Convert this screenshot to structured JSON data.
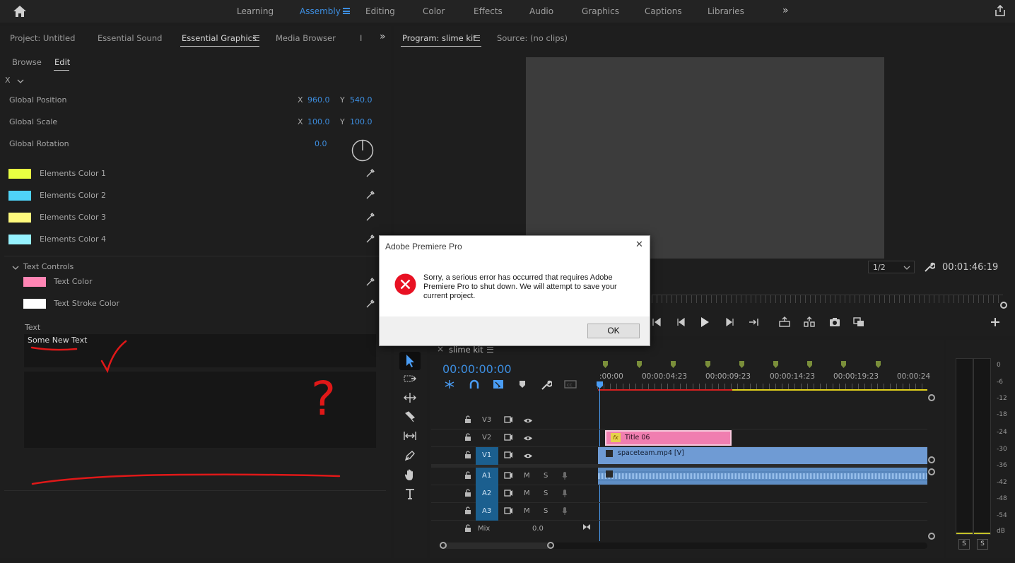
{
  "workspace_tabs": [
    "Learning",
    "Assembly",
    "Editing",
    "Color",
    "Effects",
    "Audio",
    "Graphics",
    "Captions",
    "Libraries"
  ],
  "workspace_active": "Assembly",
  "left_panel": {
    "tabs": [
      "Project: Untitled",
      "Essential Sound",
      "Essential Graphics",
      "Media Browser",
      "I"
    ],
    "active_tab": "Essential Graphics",
    "subtabs": [
      "Browse",
      "Edit"
    ],
    "active_subtab": "Edit",
    "layer_name": "X",
    "global_position": {
      "label": "Global Position",
      "x_label": "X",
      "x": "960.0",
      "y_label": "Y",
      "y": "540.0"
    },
    "global_scale": {
      "label": "Global Scale",
      "x_label": "X",
      "x": "100.0",
      "y_label": "Y",
      "y": "100.0"
    },
    "global_rotation": {
      "label": "Global Rotation",
      "value": "0.0"
    },
    "element_colors": [
      {
        "label": "Elements Color 1",
        "color": "#e8ff42"
      },
      {
        "label": "Elements Color 2",
        "color": "#4fd3f7"
      },
      {
        "label": "Elements Color 3",
        "color": "#fffa7d"
      },
      {
        "label": "Elements Color 4",
        "color": "#96f2ff"
      }
    ],
    "text_controls": {
      "label": "Text Controls",
      "items": [
        {
          "label": "Text Color",
          "color": "#ff85b4"
        },
        {
          "label": "Text Stroke Color",
          "color": "#ffffff"
        }
      ]
    },
    "text_label": "Text",
    "text_value": "Some New Text",
    "annotation_mark": "?"
  },
  "program_panel": {
    "tabs": [
      "Program: slime kit",
      "Source: (no clips)"
    ],
    "resolution": "1/2",
    "timecode": "00:01:46:19"
  },
  "dialog": {
    "title": "Adobe Premiere Pro",
    "message": "Sorry, a serious error has occurred that requires Adobe Premiere Pro to shut down. We will attempt to save your current project.",
    "ok_label": "OK",
    "close_glyph": "✕"
  },
  "timeline": {
    "close_glyph": "×",
    "sequence_name": "slime kit",
    "timecode": "00:00:00:00",
    "ruler_labels": [
      ":00:00",
      "00:00:04:23",
      "00:00:09:23",
      "00:00:14:23",
      "00:00:19:23",
      "00:00:24"
    ],
    "video_tracks": [
      "V3",
      "V2",
      "V1"
    ],
    "audio_tracks": [
      "A1",
      "A2",
      "A3"
    ],
    "mute_label": "M",
    "solo_label": "S",
    "mix_label": "Mix",
    "mix_value": "0.0",
    "clips": {
      "title": {
        "label": "Title 06",
        "fx": "fx",
        "color": "#f07eb0"
      },
      "video": {
        "label": "spaceteam.mp4 [V]",
        "color": "#6f9bd4"
      }
    }
  },
  "audio_meter": {
    "scale": [
      "0",
      "-6",
      "-12",
      "-18",
      "-24",
      "-30",
      "-36",
      "-42",
      "-48",
      "-54",
      "dB"
    ],
    "solo_buttons": [
      "S",
      "S"
    ]
  }
}
